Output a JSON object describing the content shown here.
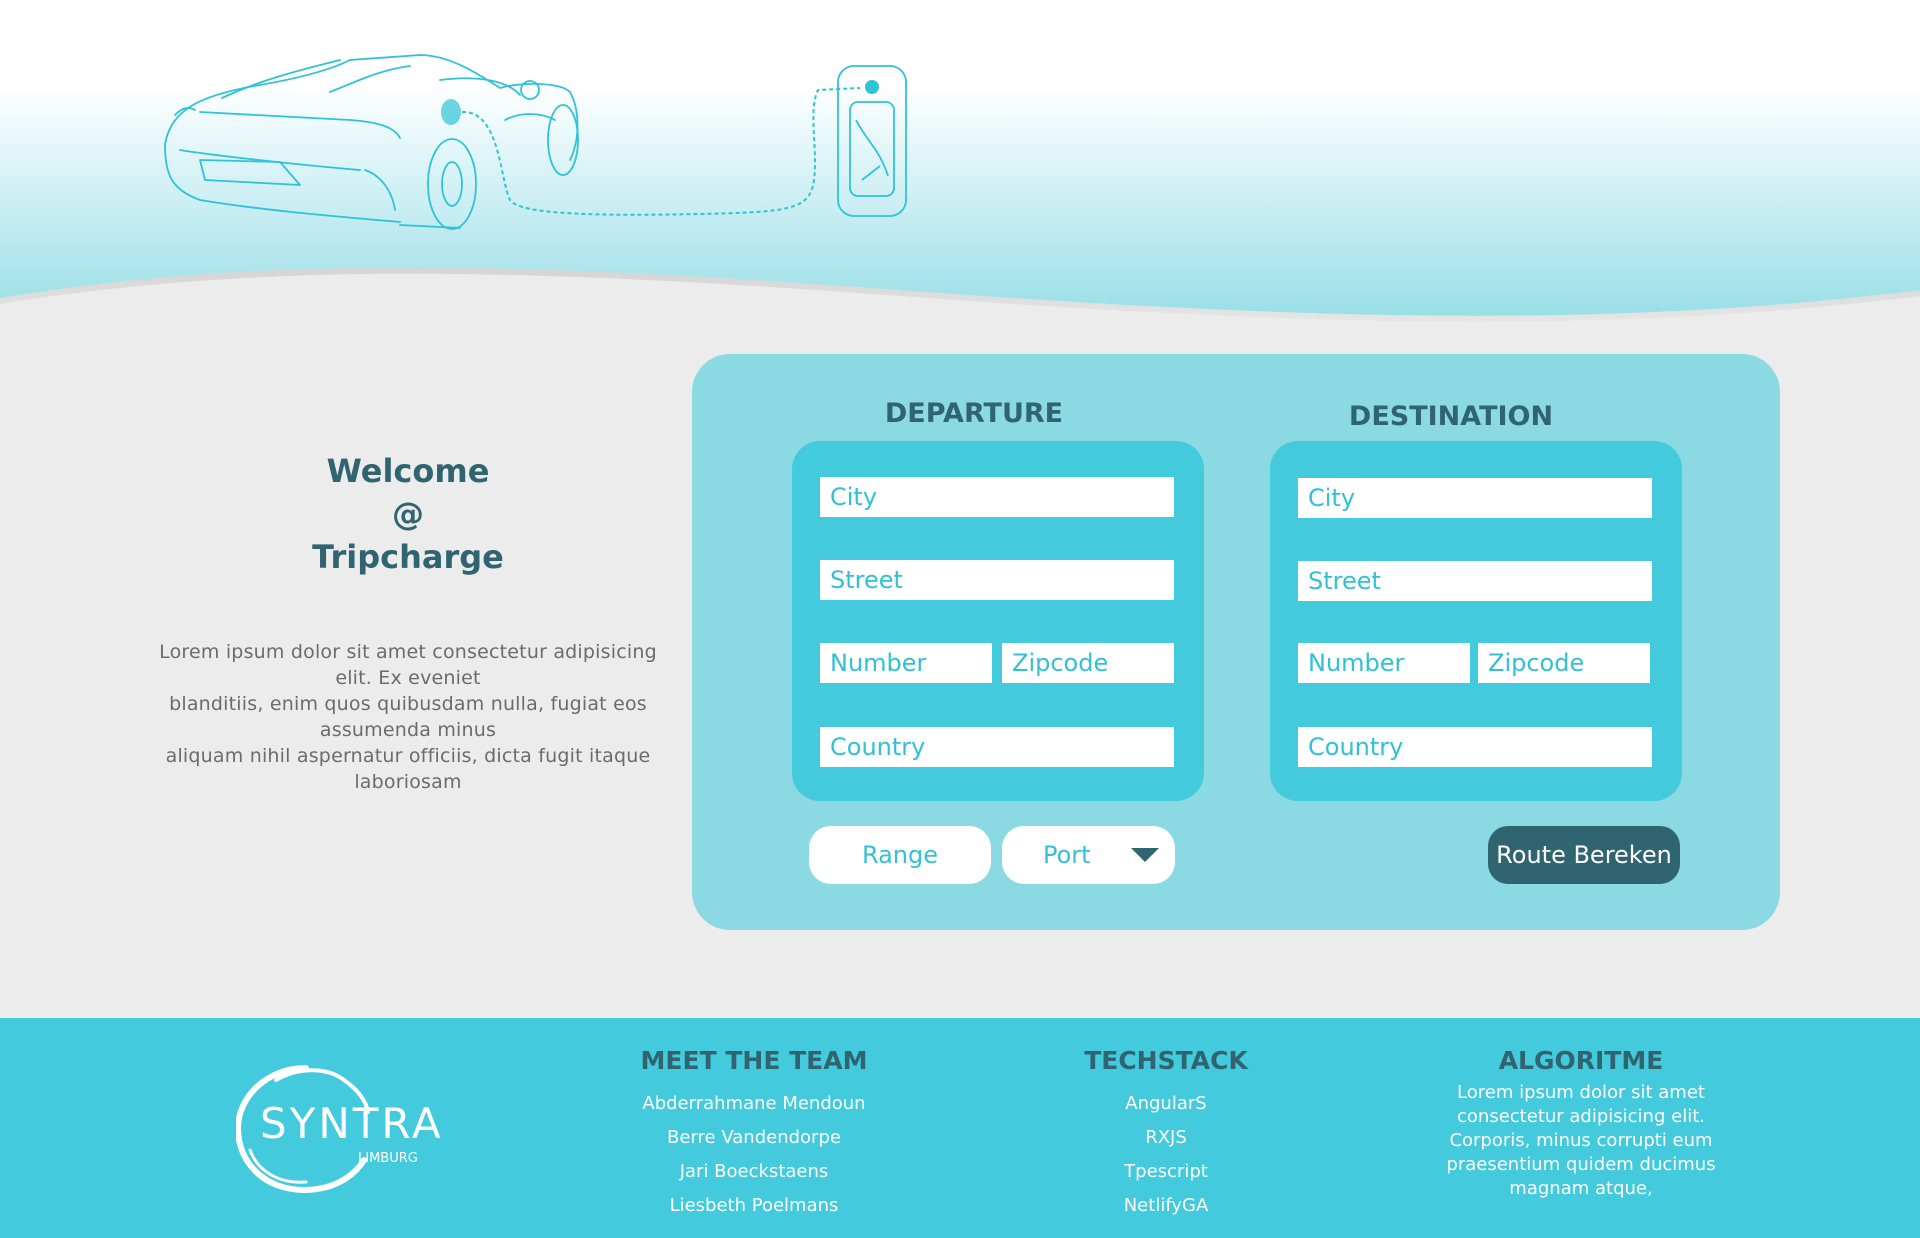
{
  "welcome": {
    "line1": "Welcome",
    "line2": "@",
    "line3": "Tripcharge",
    "intro_lines": [
      "Lorem ipsum dolor sit amet consectetur adipisicing",
      "elit. Ex eveniet",
      "blanditiis, enim quos quibusdam nulla, fugiat eos",
      "assumenda minus",
      "aliquam nihil aspernatur officiis, dicta fugit itaque",
      "laboriosam"
    ]
  },
  "departure": {
    "title": "DEPARTURE",
    "city_placeholder": "City",
    "street_placeholder": "Street",
    "number_placeholder": "Number",
    "zipcode_placeholder": "Zipcode",
    "country_placeholder": "Country"
  },
  "destination": {
    "title": "DESTINATION",
    "city_placeholder": "City",
    "street_placeholder": "Street",
    "number_placeholder": "Number",
    "zipcode_placeholder": "Zipcode",
    "country_placeholder": "Country"
  },
  "controls": {
    "range_label": "Range",
    "port_label": "Port",
    "route_button": "Route Bereken"
  },
  "footer": {
    "logo_text": "SYNTRA",
    "logo_subtext": "LIMBURG",
    "team_title": "MEET THE TEAM",
    "team": [
      "Abderrahmane Mendoun",
      "Berre Vandendorpe",
      "Jari Boeckstaens",
      "Liesbeth Poelmans"
    ],
    "tech_title": "TECHSTACK",
    "tech": [
      "AngularS",
      "RXJS",
      "Tpescript",
      "NetlifyGA"
    ],
    "algo_title": "ALGORITME",
    "algo_lines": [
      "Lorem ipsum dolor sit amet",
      "consectetur adipisicing elit.",
      "Corporis, minus corrupti eum",
      "praesentium quidem ducimus",
      "magnam atque,"
    ]
  },
  "colors": {
    "accent": "#43cadc",
    "panel": "#8bd9e3",
    "dark": "#2f6470",
    "background": "#ececec"
  }
}
